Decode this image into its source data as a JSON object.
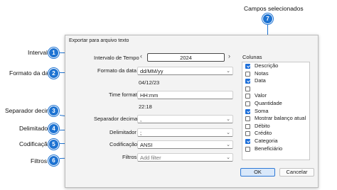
{
  "dialog": {
    "title": "Exportar para arquivo texto",
    "interval_label": "Intervalo de Tempo",
    "year": "2024",
    "date_format_label": "Formato da data",
    "date_format_value": "dd/MM/yy",
    "date_preview": "04/12/23",
    "time_format_label": "Time format",
    "time_format_value": "HH:mm",
    "time_preview": "22:18",
    "decimal_separator_label": "Separador decimal",
    "decimal_separator_value": ",",
    "delimiter_label": "Delimitador",
    "delimiter_value": ";",
    "encoding_label": "Codificação",
    "encoding_value": "ANSI",
    "filters_label": "Filtros",
    "filters_placeholder": "Add filter",
    "columns_label": "Colunas",
    "columns": [
      {
        "label": "Descrição",
        "checked": true
      },
      {
        "label": "Notas",
        "checked": false
      },
      {
        "label": "Data",
        "checked": true
      },
      {
        "label": "",
        "checked": false
      },
      {
        "label": "Valor",
        "checked": false
      },
      {
        "label": "Quantidade",
        "checked": false
      },
      {
        "label": "Soma",
        "checked": true
      },
      {
        "label": "Mostrar balanço atual",
        "checked": false
      },
      {
        "label": "Débito",
        "checked": false
      },
      {
        "label": "Crédito",
        "checked": false
      },
      {
        "label": "Categoria",
        "checked": true
      },
      {
        "label": "Beneficiário",
        "checked": false
      }
    ],
    "ok_label": "OK",
    "cancel_label": "Cancelar"
  },
  "annotations": {
    "campos": {
      "number": "7",
      "label": "Campos selecionados"
    },
    "intervalo": {
      "number": "1",
      "label": "Intervalo"
    },
    "formato": {
      "number": "2",
      "label": "Formato da data"
    },
    "separador": {
      "number": "3",
      "label": "Separador decimal"
    },
    "delimitador": {
      "number": "4",
      "label": "Delimitador"
    },
    "codificacao": {
      "number": "5",
      "label": "Codificação"
    },
    "filtros": {
      "number": "6",
      "label": "Filtros"
    }
  },
  "colors": {
    "accent": "#1e73d2",
    "checkbox": "#1e6fd9"
  },
  "icons": {
    "dropdown": "chevron-down-icon",
    "prev": "chevron-left-icon",
    "next": "chevron-right-icon",
    "check": "check-icon"
  }
}
